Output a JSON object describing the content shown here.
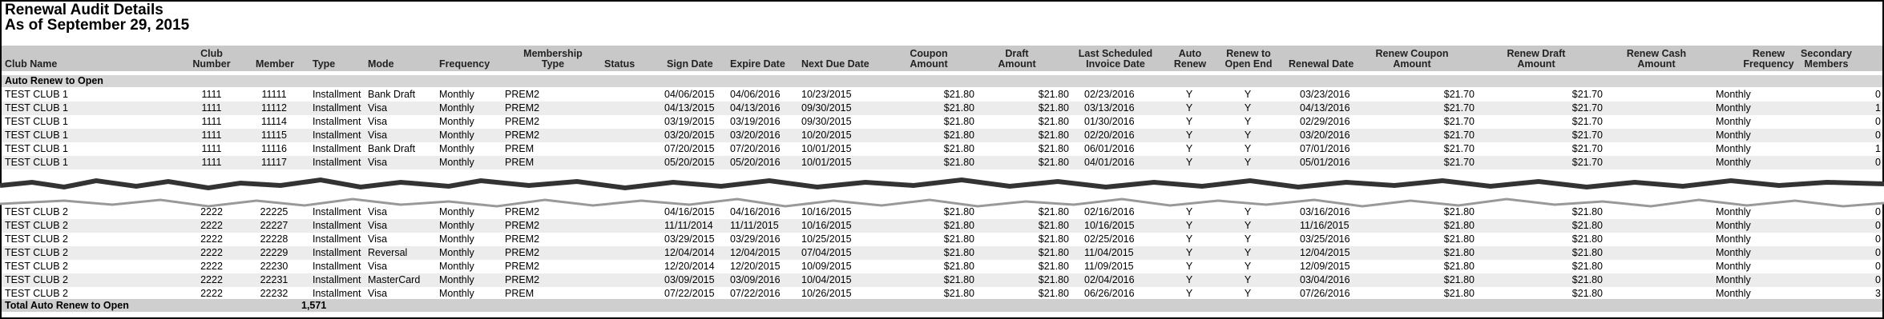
{
  "report": {
    "title": "Renewal Audit Details",
    "subtitle": "As of September 29, 2015"
  },
  "columns": [
    {
      "key": "club_name",
      "label": "Club Name"
    },
    {
      "key": "club_number",
      "label": "Club Number"
    },
    {
      "key": "member",
      "label": "Member"
    },
    {
      "key": "type",
      "label": "Type"
    },
    {
      "key": "mode",
      "label": "Mode"
    },
    {
      "key": "frequency",
      "label": "Frequency"
    },
    {
      "key": "membership_type",
      "label": "Membership Type"
    },
    {
      "key": "status",
      "label": "Status"
    },
    {
      "key": "sign_date",
      "label": "Sign Date"
    },
    {
      "key": "expire_date",
      "label": "Expire Date"
    },
    {
      "key": "next_due_date",
      "label": "Next Due Date"
    },
    {
      "key": "coupon_amount",
      "label": "Coupon Amount"
    },
    {
      "key": "draft_amount",
      "label": "Draft Amount"
    },
    {
      "key": "last_scheduled_invoice_date",
      "label": "Last Scheduled Invoice Date"
    },
    {
      "key": "auto_renew",
      "label": "Auto Renew"
    },
    {
      "key": "renew_to_open_end",
      "label": "Renew to Open End"
    },
    {
      "key": "renewal_date",
      "label": "Renewal Date"
    },
    {
      "key": "renew_coupon_amount",
      "label": "Renew Coupon Amount"
    },
    {
      "key": "renew_draft_amount",
      "label": "Renew Draft Amount"
    },
    {
      "key": "renew_cash_amount",
      "label": "Renew Cash Amount"
    },
    {
      "key": "renew_frequency",
      "label": "Renew Frequency"
    },
    {
      "key": "secondary_members",
      "label": "Secondary Members"
    }
  ],
  "section_label": "Auto Renew to Open",
  "rows": [
    [
      "TEST CLUB 1",
      "1111",
      "11111",
      "Installment",
      "Bank Draft",
      "Monthly",
      "PREM2",
      "",
      "04/06/2015",
      "04/06/2016",
      "10/23/2015",
      "$21.80",
      "$21.80",
      "02/23/2016",
      "Y",
      "Y",
      "03/23/2016",
      "$21.70",
      "$21.70",
      "",
      "Monthly",
      "0"
    ],
    [
      "TEST CLUB 1",
      "1111",
      "11112",
      "Installment",
      "Visa",
      "Monthly",
      "PREM2",
      "",
      "04/13/2015",
      "04/13/2016",
      "09/30/2015",
      "$21.80",
      "$21.80",
      "03/13/2016",
      "Y",
      "Y",
      "04/13/2016",
      "$21.70",
      "$21.70",
      "",
      "Monthly",
      "1"
    ],
    [
      "TEST CLUB 1",
      "1111",
      "11114",
      "Installment",
      "Visa",
      "Monthly",
      "PREM2",
      "",
      "03/19/2015",
      "03/19/2016",
      "09/30/2015",
      "$21.80",
      "$21.80",
      "01/30/2016",
      "Y",
      "Y",
      "02/29/2016",
      "$21.70",
      "$21.70",
      "",
      "Monthly",
      "0"
    ],
    [
      "TEST CLUB 1",
      "1111",
      "11115",
      "Installment",
      "Visa",
      "Monthly",
      "PREM2",
      "",
      "03/20/2015",
      "03/20/2016",
      "10/20/2015",
      "$21.80",
      "$21.80",
      "02/20/2016",
      "Y",
      "Y",
      "03/20/2016",
      "$21.70",
      "$21.70",
      "",
      "Monthly",
      "0"
    ],
    [
      "TEST CLUB 1",
      "1111",
      "11116",
      "Installment",
      "Bank Draft",
      "Monthly",
      "PREM",
      "",
      "07/20/2015",
      "07/20/2016",
      "10/01/2015",
      "$21.80",
      "$21.80",
      "06/01/2016",
      "Y",
      "Y",
      "07/01/2016",
      "$21.70",
      "$21.70",
      "",
      "Monthly",
      "1"
    ],
    [
      "TEST CLUB 1",
      "1111",
      "11117",
      "Installment",
      "Visa",
      "Monthly",
      "PREM",
      "",
      "05/20/2015",
      "05/20/2016",
      "10/01/2015",
      "$21.80",
      "$21.80",
      "04/01/2016",
      "Y",
      "Y",
      "05/01/2016",
      "$21.70",
      "$21.70",
      "",
      "Monthly",
      "0"
    ],
    [
      "TEST CLUB 2",
      "2222",
      "22225",
      "Installment",
      "Visa",
      "Monthly",
      "PREM2",
      "",
      "04/16/2015",
      "04/16/2016",
      "10/16/2015",
      "$21.80",
      "$21.80",
      "02/16/2016",
      "Y",
      "Y",
      "03/16/2016",
      "$21.80",
      "$21.80",
      "",
      "Monthly",
      "0"
    ],
    [
      "TEST CLUB 2",
      "2222",
      "22227",
      "Installment",
      "Visa",
      "Monthly",
      "PREM2",
      "",
      "11/11/2014",
      "11/11/2015",
      "10/16/2015",
      "$21.80",
      "$21.80",
      "10/16/2015",
      "Y",
      "Y",
      "11/16/2015",
      "$21.80",
      "$21.80",
      "",
      "Monthly",
      "0"
    ],
    [
      "TEST CLUB 2",
      "2222",
      "22228",
      "Installment",
      "Visa",
      "Monthly",
      "PREM2",
      "",
      "03/29/2015",
      "03/29/2016",
      "10/25/2015",
      "$21.80",
      "$21.80",
      "02/25/2016",
      "Y",
      "Y",
      "03/25/2016",
      "$21.80",
      "$21.80",
      "",
      "Monthly",
      "0"
    ],
    [
      "TEST CLUB 2",
      "2222",
      "22229",
      "Installment",
      "Reversal",
      "Monthly",
      "PREM2",
      "",
      "12/04/2014",
      "12/04/2015",
      "07/04/2015",
      "$21.80",
      "$21.80",
      "11/04/2015",
      "Y",
      "Y",
      "12/04/2015",
      "$21.80",
      "$21.80",
      "",
      "Monthly",
      "0"
    ],
    [
      "TEST CLUB 2",
      "2222",
      "22230",
      "Installment",
      "Visa",
      "Monthly",
      "PREM2",
      "",
      "12/20/2014",
      "12/20/2015",
      "10/09/2015",
      "$21.80",
      "$21.80",
      "11/09/2015",
      "Y",
      "Y",
      "12/09/2015",
      "$21.80",
      "$21.80",
      "",
      "Monthly",
      "0"
    ],
    [
      "TEST CLUB 2",
      "2222",
      "22231",
      "Installment",
      "MasterCard",
      "Monthly",
      "PREM2",
      "",
      "03/09/2015",
      "03/09/2016",
      "10/04/2015",
      "$21.80",
      "$21.80",
      "02/04/2016",
      "Y",
      "Y",
      "03/04/2016",
      "$21.80",
      "$21.80",
      "",
      "Monthly",
      "0"
    ],
    [
      "TEST CLUB 2",
      "2222",
      "22232",
      "Installment",
      "Visa",
      "Monthly",
      "PREM",
      "",
      "07/22/2015",
      "07/22/2016",
      "10/26/2015",
      "$21.80",
      "$21.80",
      "06/26/2016",
      "Y",
      "Y",
      "07/26/2016",
      "$21.80",
      "$21.80",
      "",
      "Monthly",
      "3"
    ]
  ],
  "total": {
    "label": "Total Auto Renew to Open",
    "value": "1,571"
  }
}
